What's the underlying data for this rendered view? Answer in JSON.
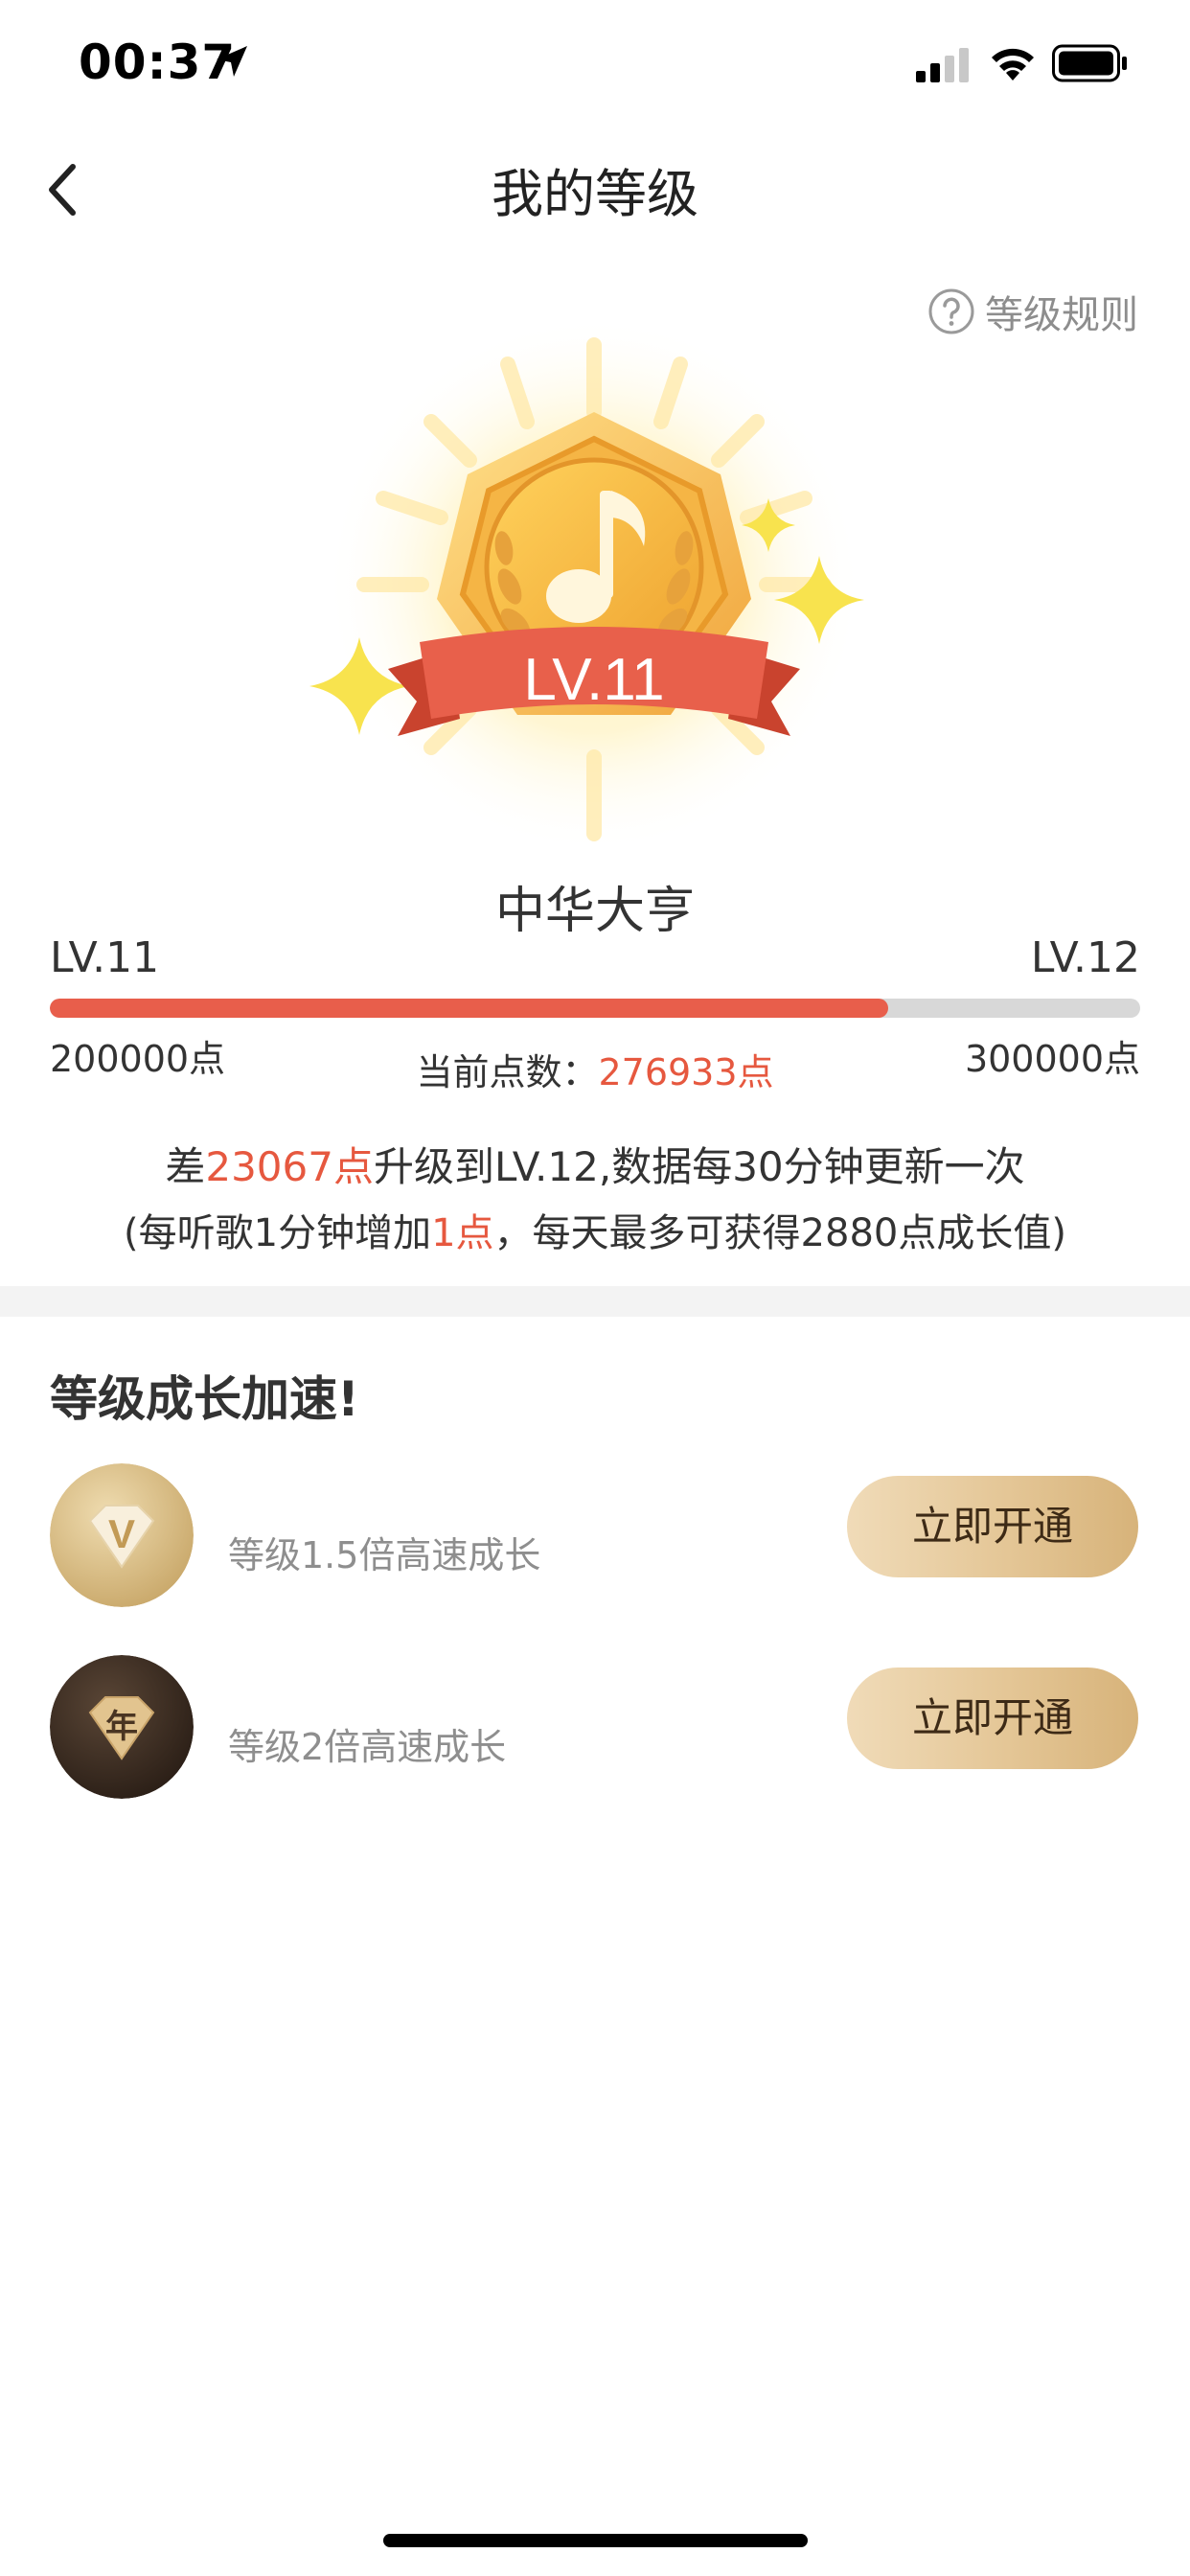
{
  "status_bar": {
    "time": "00:37"
  },
  "nav": {
    "title": "我的等级"
  },
  "rules_link": "等级规则",
  "badge": {
    "level_text": "LV.11"
  },
  "level_title": "中华大亨",
  "progress": {
    "current_level": "LV.11",
    "next_level": "LV.12",
    "min_points": "200000点",
    "max_points": "300000点",
    "current_label": "当前点数：",
    "current_value": "276933点",
    "fraction": 0.769
  },
  "upgrade_info": {
    "prefix": "差",
    "remaining": "23067点",
    "suffix": "升级到LV.12,数据每30分钟更新一次",
    "rate_prefix": "(每听歌1分钟增加",
    "rate_value": "1点",
    "rate_suffix": "，每天最多可获得2880点成长值)"
  },
  "boost_section": {
    "title": "等级成长加速!",
    "items": [
      {
        "icon": "vip-diamond-icon",
        "icon_glyph": "V",
        "text": "等级1.5倍高速成长",
        "button": "立即开通"
      },
      {
        "icon": "annual-diamond-icon",
        "icon_glyph": "年",
        "text": "等级2倍高速成长",
        "button": "立即开通"
      }
    ]
  },
  "colors": {
    "accent": "#e6583f",
    "progress_fill": "#e85e4b",
    "gold_button": "#e4c696"
  }
}
